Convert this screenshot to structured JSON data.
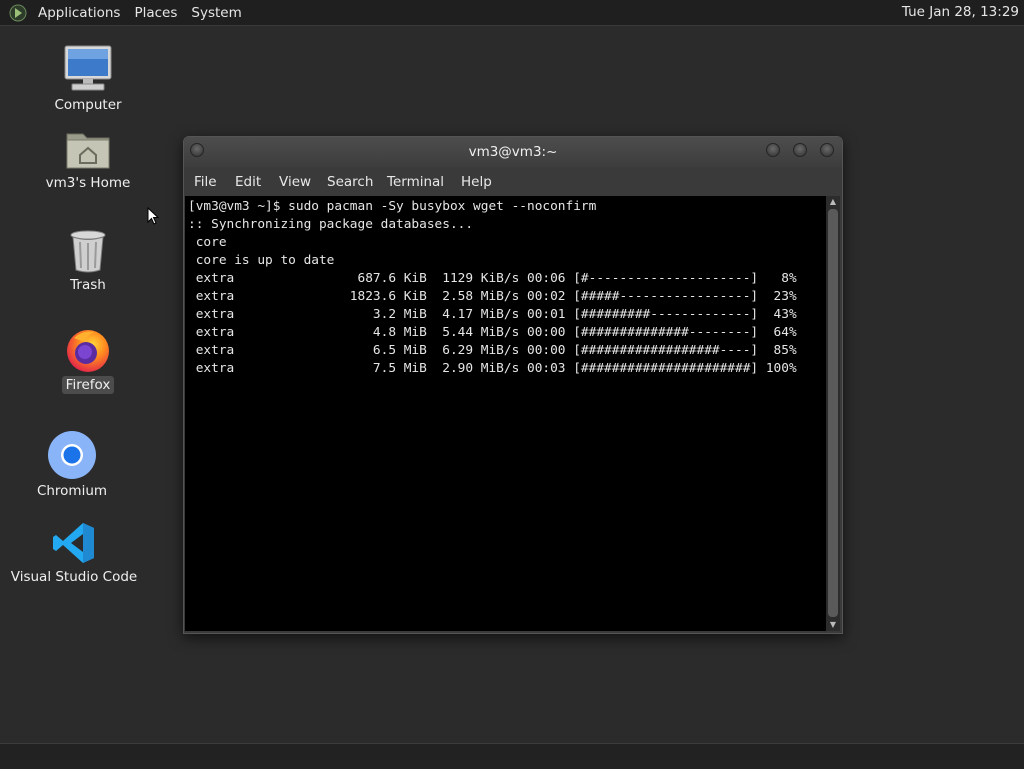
{
  "top_panel": {
    "menus": [
      "Applications",
      "Places",
      "System"
    ],
    "clock": "Tue Jan 28, 13:29"
  },
  "desktop": {
    "icons": [
      {
        "label": "Computer",
        "icon": "computer-icon"
      },
      {
        "label": "vm3's Home",
        "icon": "home-folder-icon"
      },
      {
        "label": "Trash",
        "icon": "trash-icon"
      },
      {
        "label": "Firefox",
        "icon": "firefox-icon",
        "selected": true
      },
      {
        "label": "Chromium",
        "icon": "chromium-icon"
      },
      {
        "label": "Visual Studio Code",
        "icon": "vscode-icon"
      }
    ]
  },
  "terminal": {
    "title": "vm3@vm3:~",
    "menu": [
      "File",
      "Edit",
      "View",
      "Search",
      "Terminal",
      "Help"
    ],
    "lines": [
      "[vm3@vm3 ~]$ sudo pacman -Sy busybox wget --noconfirm",
      ":: Synchronizing package databases...",
      " core",
      " core is up to date",
      " extra                687.6 KiB  1129 KiB/s 00:06 [#---------------------]   8%",
      " extra               1823.6 KiB  2.58 MiB/s 00:02 [#####-----------------]  23%",
      " extra                  3.2 MiB  4.17 MiB/s 00:01 [#########-------------]  43%",
      " extra                  4.8 MiB  5.44 MiB/s 00:00 [##############--------]  64%",
      " extra                  6.5 MiB  6.29 MiB/s 00:00 [##################----]  85%",
      " extra                  7.5 MiB  2.90 MiB/s 00:03 [######################] 100%"
    ]
  }
}
